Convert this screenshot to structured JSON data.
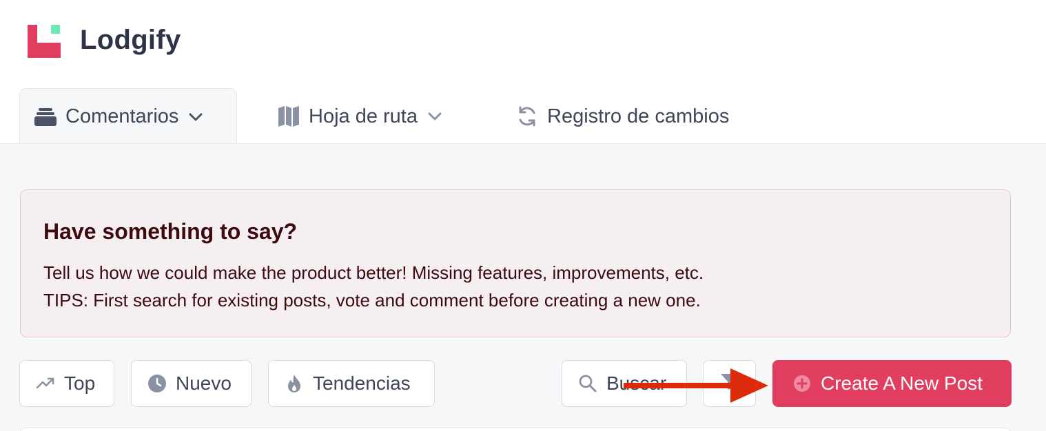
{
  "brand": {
    "name": "Lodgify"
  },
  "tabs": [
    {
      "label": "Comentarios",
      "icon": "inbox-stack-icon",
      "active": true
    },
    {
      "label": "Hoja de ruta",
      "icon": "map-icon",
      "active": false
    },
    {
      "label": "Registro de cambios",
      "icon": "refresh-icon",
      "active": false
    }
  ],
  "banner": {
    "title": "Have something to say?",
    "line1": "Tell us how we could make the product better! Missing features, improvements, etc.",
    "line2": "TIPS: First search for existing posts, vote and comment before creating a new one."
  },
  "toolbar": {
    "top_label": "Top",
    "new_label": "Nuevo",
    "trending_label": "Tendencias",
    "search_label": "Buscar",
    "create_label": "Create A New Post"
  },
  "colors": {
    "accent": "#e13e5f",
    "logo_red": "#e13e5f",
    "logo_green": "#6ee7b7",
    "annotation_arrow": "#dd2a0a"
  }
}
